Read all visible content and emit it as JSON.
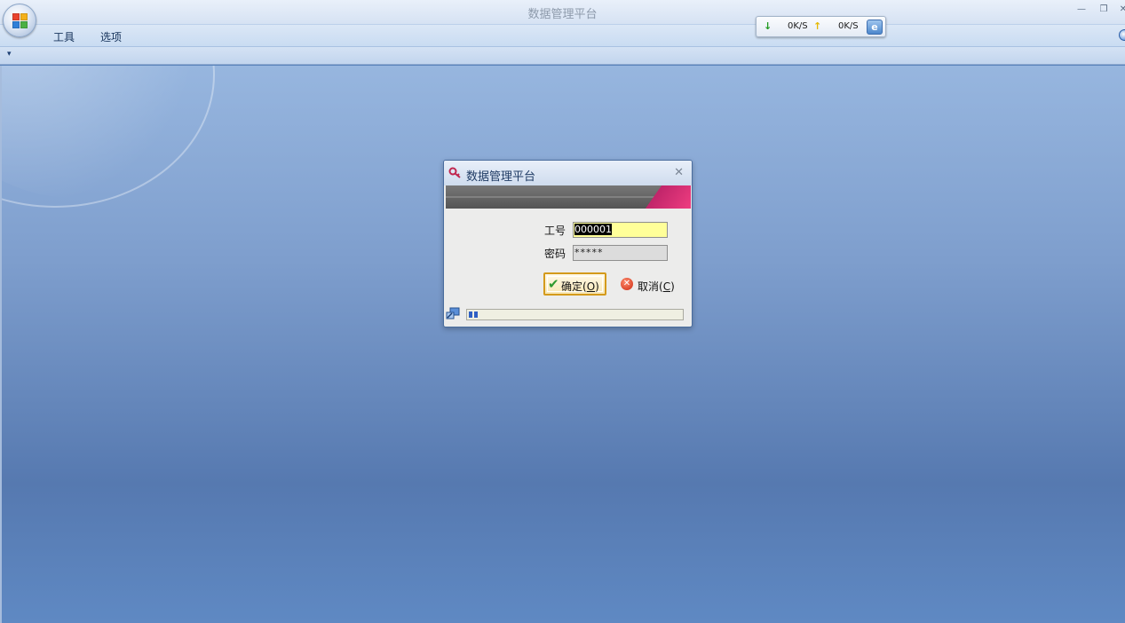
{
  "window": {
    "title": "数据管理平台"
  },
  "menu": {
    "items": [
      "工具",
      "选项"
    ]
  },
  "speed": {
    "down": "0K/S",
    "up": "0K/S",
    "colors": {
      "down_arrow": "#1f9a1f",
      "up_arrow": "#e5b800"
    }
  },
  "dialog": {
    "title": "数据管理平台",
    "id_label": "工号",
    "id_value": "000001",
    "password_label": "密码",
    "password_value": "*****",
    "ok_label": "确定",
    "ok_shortcut": "O",
    "cancel_label": "取消",
    "cancel_shortcut": "C",
    "progress": 0.04
  },
  "colors": {
    "accent": "#ef3d80",
    "desktop": "#5b84bb",
    "input_highlight": "#ffff99"
  }
}
